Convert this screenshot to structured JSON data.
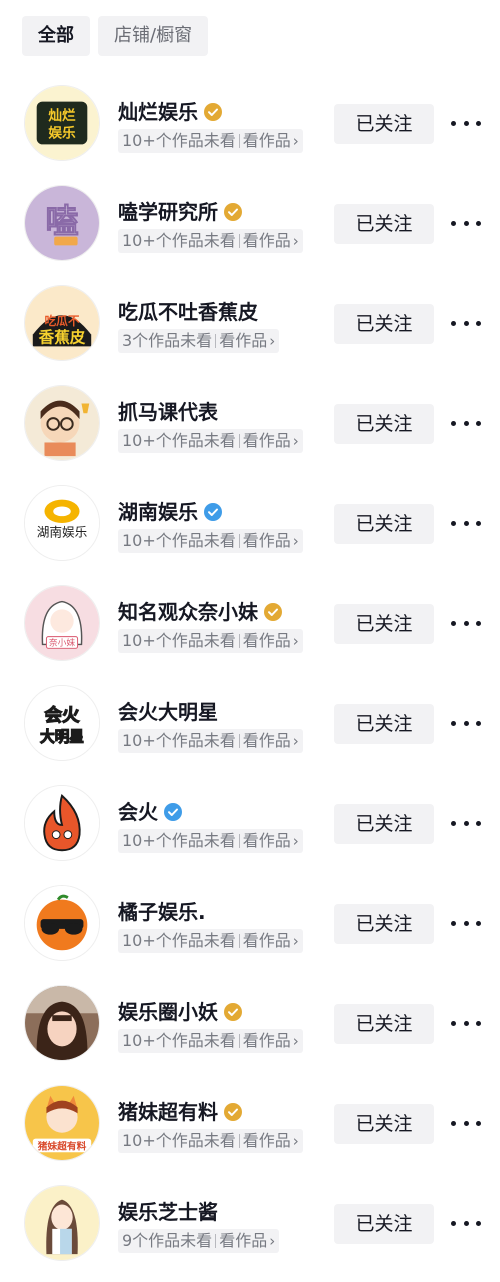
{
  "tabs": [
    {
      "label": "全部",
      "active": true
    },
    {
      "label": "店铺/橱窗",
      "active": false
    }
  ],
  "accounts": [
    {
      "name": "灿烂娱乐",
      "badge": "gold",
      "sub": "10+个作品未看",
      "link": "看作品",
      "follow": "已关注",
      "avatar_text": "灿烂娱乐",
      "avatar_bg": "#1f2a1e",
      "avatar_fg": "#f5c82a"
    },
    {
      "name": "嗑学研究所",
      "badge": "gold",
      "sub": "10+个作品未看",
      "link": "看作品",
      "follow": "已关注",
      "avatar_text": "嗑",
      "avatar_bg": "#c9b6d9",
      "avatar_fg": "#ffffff"
    },
    {
      "name": "吃瓜不吐香蕉皮",
      "badge": "none",
      "sub": "3个作品未看",
      "link": "看作品",
      "follow": "已关注",
      "avatar_text": "香蕉皮",
      "avatar_bg": "#1b1b1b",
      "avatar_fg": "#f6d12e"
    },
    {
      "name": "抓马课代表",
      "badge": "none",
      "sub": "10+个作品未看",
      "link": "看作品",
      "follow": "已关注",
      "avatar_text": "",
      "avatar_bg": "#f4ead7",
      "avatar_fg": "#3a2a1e"
    },
    {
      "name": "湖南娱乐",
      "badge": "blue",
      "sub": "10+个作品未看",
      "link": "看作品",
      "follow": "已关注",
      "avatar_text": "湖南娱乐",
      "avatar_bg": "#ffffff",
      "avatar_fg": "#222222"
    },
    {
      "name": "知名观众奈小妹",
      "badge": "gold",
      "sub": "10+个作品未看",
      "link": "看作品",
      "follow": "已关注",
      "avatar_text": "奈小妹",
      "avatar_bg": "#f7dde2",
      "avatar_fg": "#d9566d"
    },
    {
      "name": "会火大明星",
      "badge": "none",
      "sub": "10+个作品未看",
      "link": "看作品",
      "follow": "已关注",
      "avatar_text": "会火",
      "avatar_bg": "#ffffff",
      "avatar_fg": "#f08a18"
    },
    {
      "name": "会火",
      "badge": "blue",
      "sub": "10+个作品未看",
      "link": "看作品",
      "follow": "已关注",
      "avatar_text": "",
      "avatar_bg": "#ffffff",
      "avatar_fg": "#e8562a"
    },
    {
      "name": "橘子娱乐.",
      "badge": "none",
      "sub": "10+个作品未看",
      "link": "看作品",
      "follow": "已关注",
      "avatar_text": "",
      "avatar_bg": "#ffffff",
      "avatar_fg": "#f07a1e"
    },
    {
      "name": "娱乐圈小妖",
      "badge": "gold",
      "sub": "10+个作品未看",
      "link": "看作品",
      "follow": "已关注",
      "avatar_text": "",
      "avatar_bg": "#8c6e5a",
      "avatar_fg": "#3b2418"
    },
    {
      "name": "猪妹超有料",
      "badge": "gold",
      "sub": "10+个作品未看",
      "link": "看作品",
      "follow": "已关注",
      "avatar_text": "猪妹超有料",
      "avatar_bg": "#f7c54a",
      "avatar_fg": "#d94a2c"
    },
    {
      "name": "娱乐芝士酱",
      "badge": "none",
      "sub": "9个作品未看",
      "link": "看作品",
      "follow": "已关注",
      "avatar_text": "",
      "avatar_bg": "#fbf1c8",
      "avatar_fg": "#6a4a3a"
    }
  ],
  "colors": {
    "gold_badge": "#e3a934",
    "blue_badge": "#3f9ce8"
  }
}
